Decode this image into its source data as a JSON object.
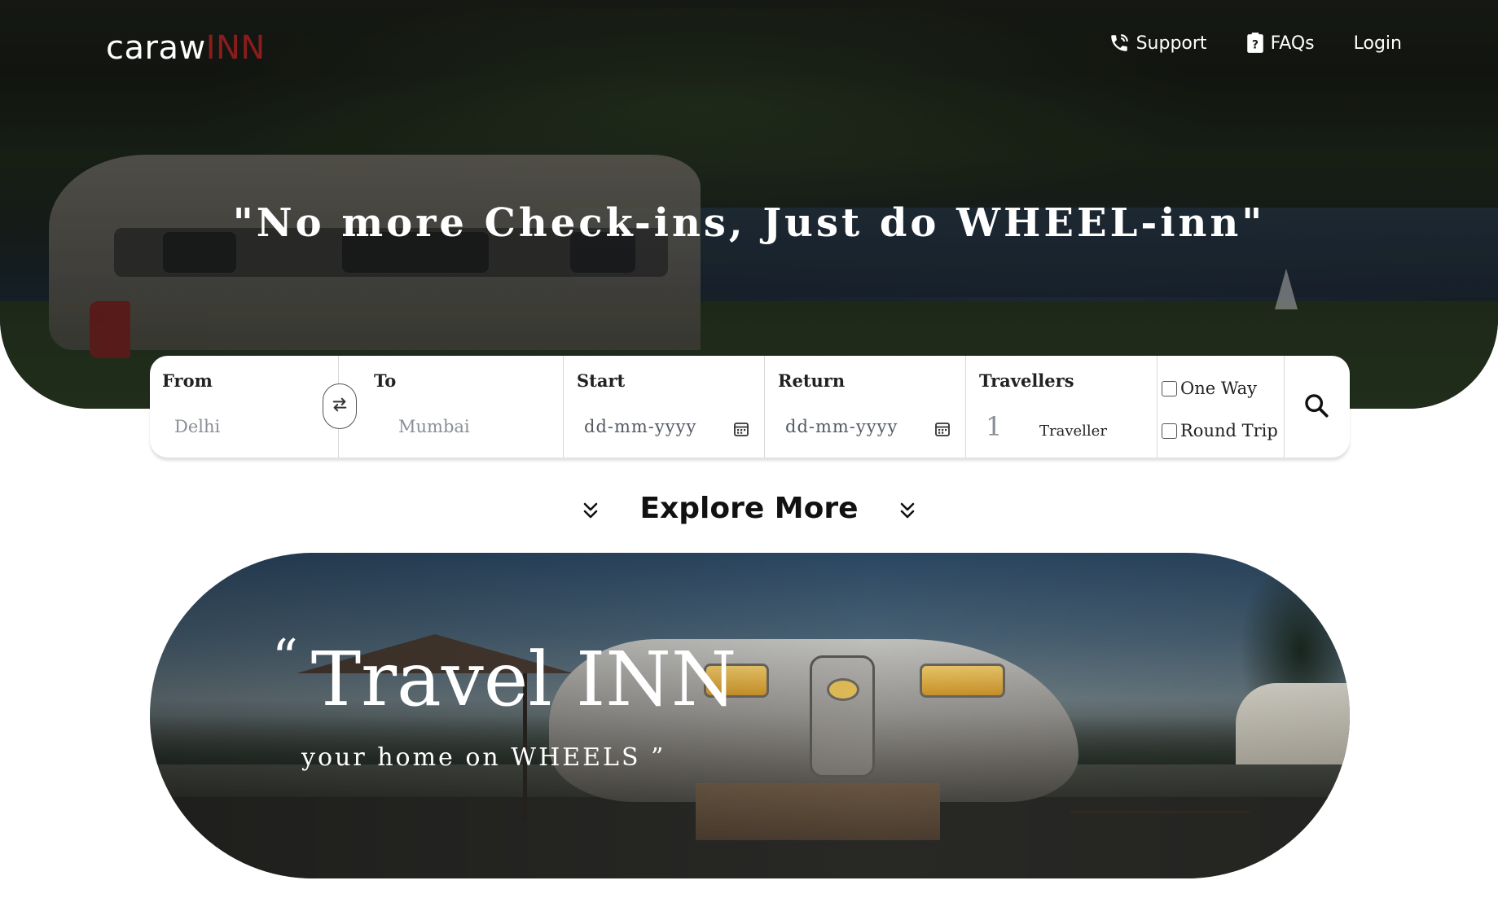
{
  "brand": {
    "name_main": "caraw",
    "name_accent": "INN"
  },
  "nav": {
    "support": "Support",
    "faqs": "FAQs",
    "login": "Login"
  },
  "hero": {
    "tagline": "\"No more Check-ins, Just do WHEEL-inn\""
  },
  "search": {
    "from_label": "From",
    "from_placeholder": "Delhi",
    "to_label": "To",
    "to_placeholder": "Mumbai",
    "start_label": "Start",
    "start_value": "dd-mm-yyyy",
    "return_label": "Return",
    "return_value": "dd-mm-yyyy",
    "travellers_label": "Travellers",
    "travellers_count": "1",
    "travellers_unit": "Traveller",
    "one_way_label": "One Way",
    "round_trip_label": "Round Trip"
  },
  "explore": {
    "title": "Explore More"
  },
  "banner": {
    "open_quote": "“",
    "title": "Travel INN",
    "subtitle": "your home on WHEELS ”"
  },
  "colors": {
    "brand_accent": "#8b1c1c",
    "text_dark": "#111111",
    "placeholder": "#8a8f97"
  }
}
